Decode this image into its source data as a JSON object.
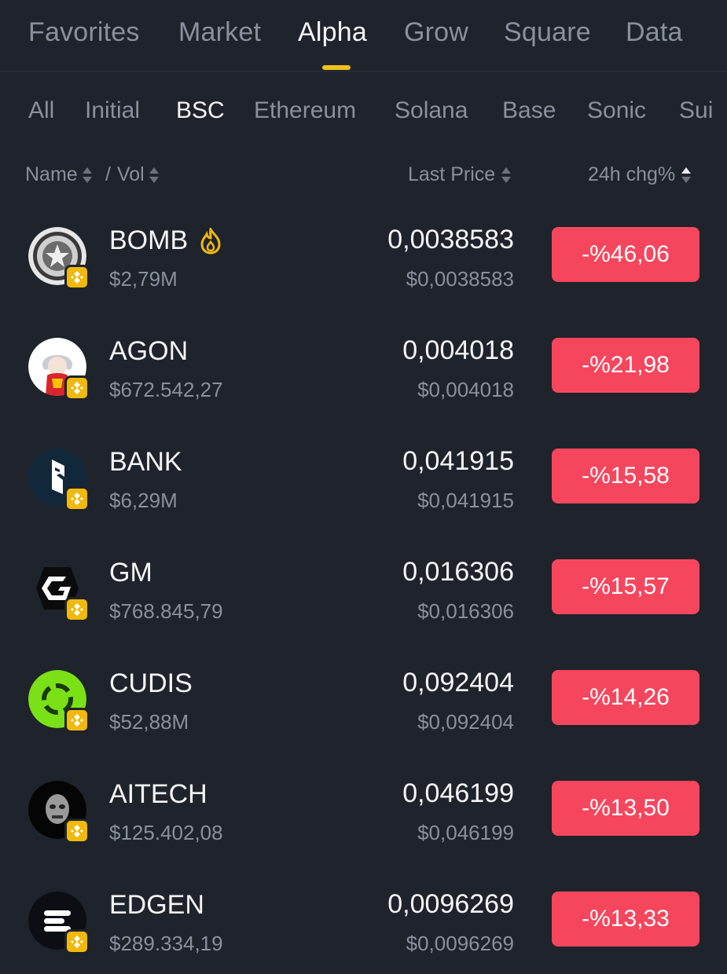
{
  "top_tabs": [
    {
      "label": "Favorites",
      "active": false
    },
    {
      "label": "Market",
      "active": false
    },
    {
      "label": "Alpha",
      "active": true
    },
    {
      "label": "Grow",
      "active": false
    },
    {
      "label": "Square",
      "active": false
    },
    {
      "label": "Data",
      "active": false
    }
  ],
  "sub_tabs": [
    {
      "label": "All",
      "active": false
    },
    {
      "label": "Initial",
      "active": false
    },
    {
      "label": "BSC",
      "active": true
    },
    {
      "label": "Ethereum",
      "active": false
    },
    {
      "label": "Solana",
      "active": false
    },
    {
      "label": "Base",
      "active": false
    },
    {
      "label": "Sonic",
      "active": false
    },
    {
      "label": "Sui",
      "active": false
    }
  ],
  "header": {
    "name": "Name",
    "separator": "/",
    "vol": "Vol",
    "last_price": "Last Price",
    "change": "24h chg%"
  },
  "colors": {
    "background": "#1f232b",
    "accent": "#f0c21a",
    "negative": "#f6465d",
    "bnb_badge": "#f0b90b"
  },
  "tokens": [
    {
      "symbol": "BOMB",
      "volume": "$2,79M",
      "price": "0,0038583",
      "price_usd": "$0,0038583",
      "change": "-%46,06",
      "hot": true,
      "icon": "bomb-token-icon"
    },
    {
      "symbol": "AGON",
      "volume": "$672.542,27",
      "price": "0,004018",
      "price_usd": "$0,004018",
      "change": "-%21,98",
      "hot": false,
      "icon": "agon-token-icon"
    },
    {
      "symbol": "BANK",
      "volume": "$6,29M",
      "price": "0,041915",
      "price_usd": "$0,041915",
      "change": "-%15,58",
      "hot": false,
      "icon": "bank-token-icon"
    },
    {
      "symbol": "GM",
      "volume": "$768.845,79",
      "price": "0,016306",
      "price_usd": "$0,016306",
      "change": "-%15,57",
      "hot": false,
      "icon": "gm-token-icon"
    },
    {
      "symbol": "CUDIS",
      "volume": "$52,88M",
      "price": "0,092404",
      "price_usd": "$0,092404",
      "change": "-%14,26",
      "hot": false,
      "icon": "cudis-token-icon"
    },
    {
      "symbol": "AITECH",
      "volume": "$125.402,08",
      "price": "0,046199",
      "price_usd": "$0,046199",
      "change": "-%13,50",
      "hot": false,
      "icon": "aitech-token-icon"
    },
    {
      "symbol": "EDGEN",
      "volume": "$289.334,19",
      "price": "0,0096269",
      "price_usd": "$0,0096269",
      "change": "-%13,33",
      "hot": false,
      "icon": "edgen-token-icon"
    }
  ]
}
